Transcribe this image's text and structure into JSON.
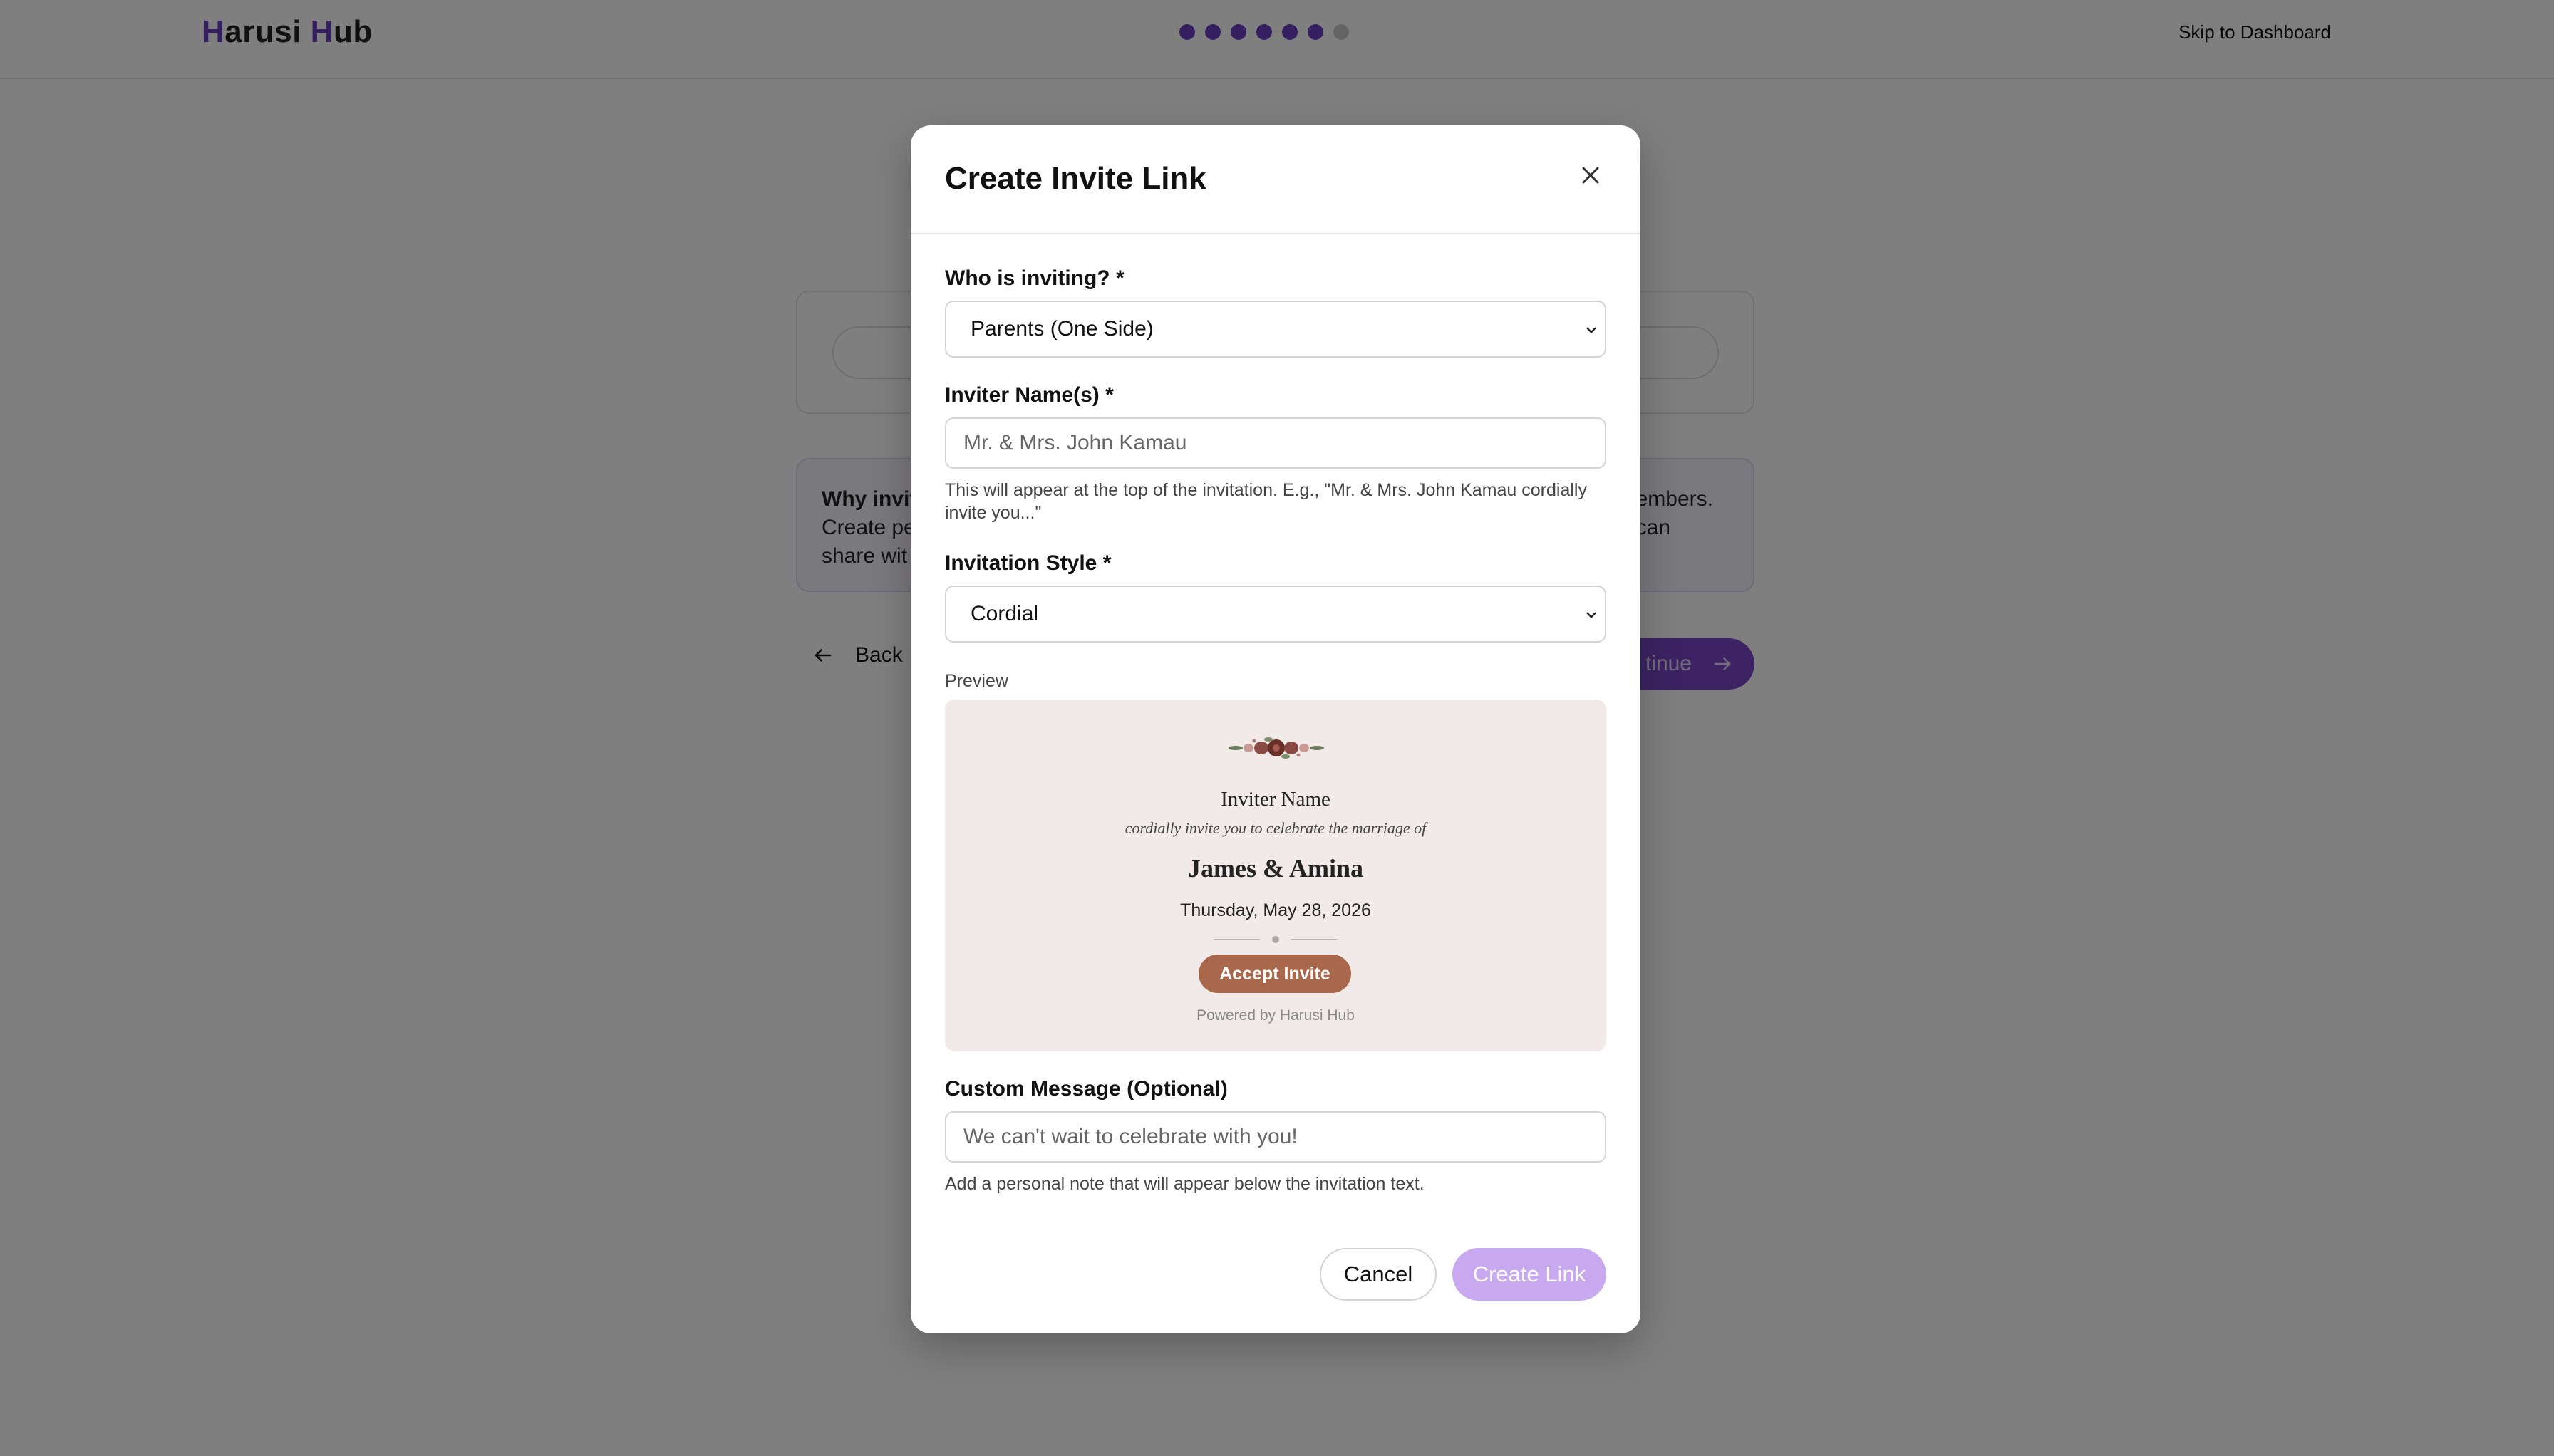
{
  "header": {
    "logo_parts": [
      "H",
      "arusi ",
      "H",
      "ub"
    ],
    "progress_total": 7,
    "progress_completed": 6,
    "skip_label": "Skip to Dashboard"
  },
  "background": {
    "info_bold": "Why invit",
    "info_line2": "Create pe",
    "info_line3": "share wit",
    "info_right1": "embers.",
    "info_right2": "can",
    "back_label": "Back",
    "continue_label": "tinue"
  },
  "modal": {
    "title": "Create Invite Link",
    "who_label": "Who is inviting? *",
    "who_value": "Parents (One Side)",
    "inviter_label": "Inviter Name(s) *",
    "inviter_placeholder": "Mr. & Mrs. John Kamau",
    "inviter_help": "This will appear at the top of the invitation. E.g., \"Mr. & Mrs. John Kamau cordially invite you...\"",
    "style_label": "Invitation Style *",
    "style_value": "Cordial",
    "preview_label": "Preview",
    "preview": {
      "inviter": "Inviter Name",
      "line": "cordially invite you to celebrate the marriage of",
      "couple": "James & Amina",
      "date": "Thursday, May 28, 2026",
      "accept": "Accept Invite",
      "powered": "Powered by Harusi Hub"
    },
    "custom_label": "Custom Message (Optional)",
    "custom_placeholder": "We can't wait to celebrate with you!",
    "custom_help": "Add a personal note that will appear below the invitation text.",
    "cancel_label": "Cancel",
    "create_label": "Create Link"
  },
  "colors": {
    "brand": "#6d3fc2",
    "create_disabled": "#c8a9f0",
    "accept": "#a9674c",
    "preview_bg": "#f1eae8"
  }
}
